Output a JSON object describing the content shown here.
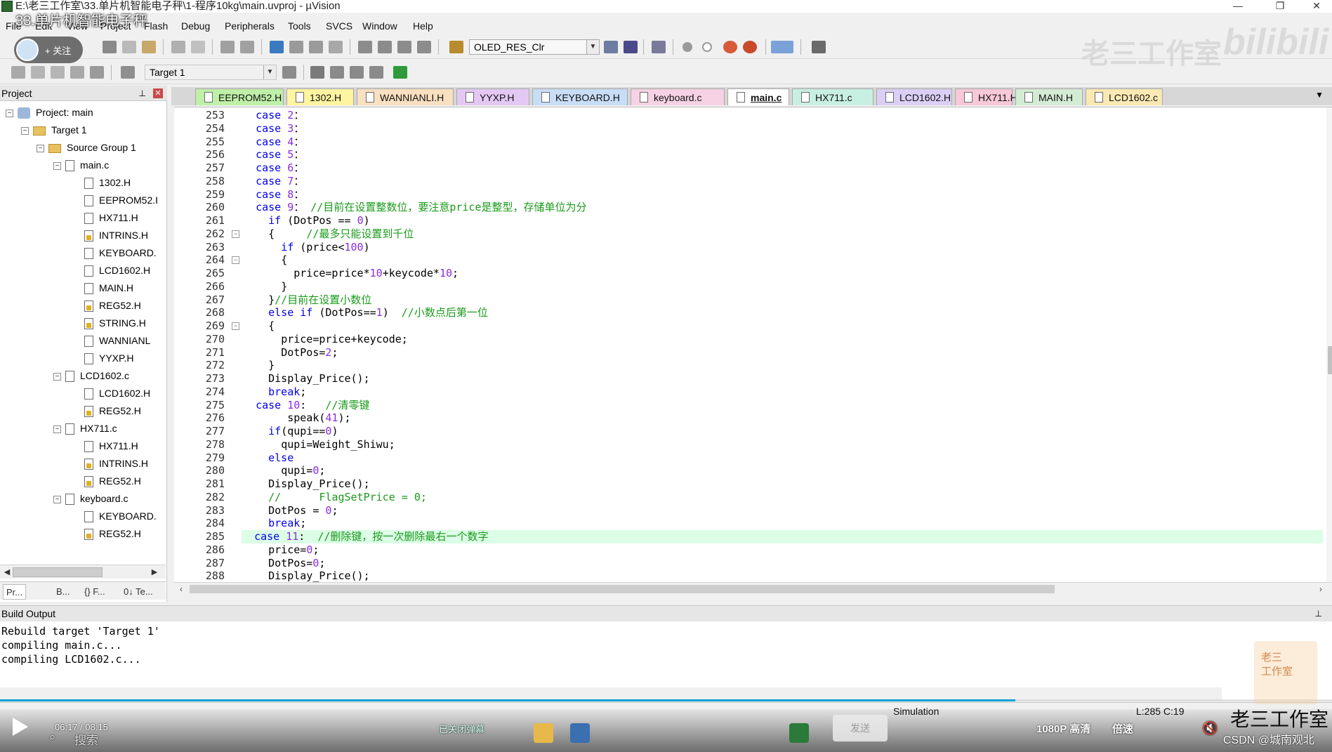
{
  "window": {
    "title": "E:\\老三工作室\\33.单片机智能电子秤\\1-程序10kg\\main.uvproj - µVision",
    "controls": {
      "minimize": "—",
      "maximize": "❐",
      "close": "✕"
    }
  },
  "video_title": "33.单片机智能电子秤",
  "follow": {
    "label": "+ 关注"
  },
  "menu": [
    "File",
    "Edit",
    "View",
    "Project",
    "Flash",
    "Debug",
    "Peripherals",
    "Tools",
    "SVCS",
    "Window",
    "Help"
  ],
  "toolbar": {
    "function_combo": "OLED_RES_Clr",
    "target_combo": "Target 1"
  },
  "project_panel": {
    "title": "Project",
    "tree": [
      {
        "label": "Project: main",
        "level": 0,
        "toggle": "-",
        "icon": "project"
      },
      {
        "label": "Target 1",
        "level": 1,
        "toggle": "-",
        "icon": "folder"
      },
      {
        "label": "Source Group 1",
        "level": 2,
        "toggle": "-",
        "icon": "folder"
      },
      {
        "label": "main.c",
        "level": 3,
        "toggle": "-",
        "icon": "file"
      },
      {
        "label": "1302.H",
        "level": 4,
        "icon": "file"
      },
      {
        "label": "EEPROM52.I",
        "level": 4,
        "icon": "file"
      },
      {
        "label": "HX711.H",
        "level": 4,
        "icon": "file"
      },
      {
        "label": "INTRINS.H",
        "level": 4,
        "icon": "file-lock"
      },
      {
        "label": "KEYBOARD.",
        "level": 4,
        "icon": "file"
      },
      {
        "label": "LCD1602.H",
        "level": 4,
        "icon": "file"
      },
      {
        "label": "MAIN.H",
        "level": 4,
        "icon": "file"
      },
      {
        "label": "REG52.H",
        "level": 4,
        "icon": "file-lock"
      },
      {
        "label": "STRING.H",
        "level": 4,
        "icon": "file-lock"
      },
      {
        "label": "WANNIANL",
        "level": 4,
        "icon": "file"
      },
      {
        "label": "YYXP.H",
        "level": 4,
        "icon": "file"
      },
      {
        "label": "LCD1602.c",
        "level": 3,
        "toggle": "-",
        "icon": "file"
      },
      {
        "label": "LCD1602.H",
        "level": 4,
        "icon": "file"
      },
      {
        "label": "REG52.H",
        "level": 4,
        "icon": "file-lock"
      },
      {
        "label": "HX711.c",
        "level": 3,
        "toggle": "-",
        "icon": "file"
      },
      {
        "label": "HX711.H",
        "level": 4,
        "icon": "file"
      },
      {
        "label": "INTRINS.H",
        "level": 4,
        "icon": "file-lock"
      },
      {
        "label": "REG52.H",
        "level": 4,
        "icon": "file-lock"
      },
      {
        "label": "keyboard.c",
        "level": 3,
        "toggle": "-",
        "icon": "file"
      },
      {
        "label": "KEYBOARD.",
        "level": 4,
        "icon": "file"
      },
      {
        "label": "REG52.H",
        "level": 4,
        "icon": "file-lock"
      }
    ],
    "bottom_tabs": [
      "Pr...",
      "B...",
      "{} F...",
      "0↓ Te..."
    ]
  },
  "editor_tabs": [
    {
      "label": "EEPROM52.H",
      "color": "#bff0a8",
      "active": false
    },
    {
      "label": "1302.H",
      "color": "#fff4a0",
      "active": false
    },
    {
      "label": "WANNIANLI.H",
      "color": "#f8e0c0",
      "active": false
    },
    {
      "label": "YYXP.H",
      "color": "#e4c8f4",
      "active": false
    },
    {
      "label": "KEYBOARD.H",
      "color": "#c8ddf6",
      "active": false
    },
    {
      "label": "keyboard.c",
      "color": "#f6d2e4",
      "active": false
    },
    {
      "label": "main.c",
      "color": "#fff3d6",
      "active": true
    },
    {
      "label": "HX711.c",
      "color": "#c8f0e2",
      "active": false
    },
    {
      "label": "LCD1602.H",
      "color": "#dccff6",
      "active": false
    },
    {
      "label": "HX711.H",
      "color": "#f6c8d8",
      "active": false
    },
    {
      "label": "MAIN.H",
      "color": "#d4ecd4",
      "active": false
    },
    {
      "label": "LCD1602.c",
      "color": "#fbe9b4",
      "active": false
    }
  ],
  "code": {
    "current_line": 285,
    "lines": [
      {
        "n": 253,
        "indent": 2,
        "parts": [
          [
            "kw",
            "case "
          ],
          [
            "num",
            "2"
          ],
          [
            "",
            "："
          ]
        ]
      },
      {
        "n": 254,
        "indent": 2,
        "parts": [
          [
            "kw",
            "case "
          ],
          [
            "num",
            "3"
          ],
          [
            "",
            "："
          ]
        ]
      },
      {
        "n": 255,
        "indent": 2,
        "parts": [
          [
            "kw",
            "case "
          ],
          [
            "num",
            "4"
          ],
          [
            "",
            "："
          ]
        ]
      },
      {
        "n": 256,
        "indent": 2,
        "parts": [
          [
            "kw",
            "case "
          ],
          [
            "num",
            "5"
          ],
          [
            "",
            "："
          ]
        ]
      },
      {
        "n": 257,
        "indent": 2,
        "parts": [
          [
            "kw",
            "case "
          ],
          [
            "num",
            "6"
          ],
          [
            "",
            "："
          ]
        ]
      },
      {
        "n": 258,
        "indent": 2,
        "parts": [
          [
            "kw",
            "case "
          ],
          [
            "num",
            "7"
          ],
          [
            "",
            "："
          ]
        ]
      },
      {
        "n": 259,
        "indent": 2,
        "parts": [
          [
            "kw",
            "case "
          ],
          [
            "num",
            "8"
          ],
          [
            "",
            "："
          ]
        ]
      },
      {
        "n": 260,
        "indent": 2,
        "parts": [
          [
            "kw",
            "case "
          ],
          [
            "num",
            "9"
          ],
          [
            "",
            "： "
          ],
          [
            "cmt",
            "//目前在设置整数位，要注意price是整型，存储单位为分"
          ]
        ]
      },
      {
        "n": 261,
        "indent": 4,
        "parts": [
          [
            "kw",
            "if "
          ],
          [
            "",
            "(DotPos == "
          ],
          [
            "num",
            "0"
          ],
          [
            "",
            ")"
          ]
        ]
      },
      {
        "n": 262,
        "indent": 4,
        "fold": "-",
        "parts": [
          [
            "",
            "{     "
          ],
          [
            "cmt",
            "//最多只能设置到千位"
          ]
        ]
      },
      {
        "n": 263,
        "indent": 6,
        "parts": [
          [
            "kw",
            "if "
          ],
          [
            "",
            "(price<"
          ],
          [
            "num",
            "100"
          ],
          [
            "",
            ")"
          ]
        ]
      },
      {
        "n": 264,
        "indent": 6,
        "fold": "-",
        "parts": [
          [
            "",
            "{"
          ]
        ]
      },
      {
        "n": 265,
        "indent": 8,
        "parts": [
          [
            "",
            "price=price*"
          ],
          [
            "num",
            "10"
          ],
          [
            "",
            "+keycode*"
          ],
          [
            "num",
            "10"
          ],
          [
            "",
            ";"
          ]
        ]
      },
      {
        "n": 266,
        "indent": 6,
        "parts": [
          [
            "",
            "}"
          ]
        ]
      },
      {
        "n": 267,
        "indent": 4,
        "parts": [
          [
            "",
            "}"
          ],
          [
            "cmt",
            "//目前在设置小数位"
          ]
        ]
      },
      {
        "n": 268,
        "indent": 4,
        "parts": [
          [
            "kw",
            "else if "
          ],
          [
            "",
            "(DotPos=="
          ],
          [
            "num",
            "1"
          ],
          [
            "",
            ")  "
          ],
          [
            "cmt",
            "//小数点后第一位"
          ]
        ]
      },
      {
        "n": 269,
        "indent": 4,
        "fold": "-",
        "parts": [
          [
            "",
            "{"
          ]
        ]
      },
      {
        "n": 270,
        "indent": 6,
        "parts": [
          [
            "",
            "price=price+keycode;"
          ]
        ]
      },
      {
        "n": 271,
        "indent": 6,
        "parts": [
          [
            "",
            "DotPos="
          ],
          [
            "num",
            "2"
          ],
          [
            "",
            ";"
          ]
        ]
      },
      {
        "n": 272,
        "indent": 4,
        "parts": [
          [
            "",
            "}"
          ]
        ]
      },
      {
        "n": 273,
        "indent": 4,
        "parts": [
          [
            "",
            "Display_Price();"
          ]
        ]
      },
      {
        "n": 274,
        "indent": 4,
        "parts": [
          [
            "kw",
            "break"
          ],
          [
            "",
            ";"
          ]
        ]
      },
      {
        "n": 275,
        "indent": 2,
        "parts": [
          [
            "kw",
            "case "
          ],
          [
            "num",
            "10"
          ],
          [
            "",
            ":   "
          ],
          [
            "cmt",
            "//清零键"
          ]
        ]
      },
      {
        "n": 276,
        "indent": 7,
        "parts": [
          [
            "",
            "speak("
          ],
          [
            "num",
            "41"
          ],
          [
            "",
            ");"
          ]
        ]
      },
      {
        "n": 277,
        "indent": 4,
        "parts": [
          [
            "kw",
            "if"
          ],
          [
            "",
            "(qupi=="
          ],
          [
            "num",
            "0"
          ],
          [
            "",
            ")"
          ]
        ]
      },
      {
        "n": 278,
        "indent": 6,
        "parts": [
          [
            "",
            "qupi=Weight_Shiwu;"
          ]
        ]
      },
      {
        "n": 279,
        "indent": 4,
        "parts": [
          [
            "kw",
            "else"
          ]
        ]
      },
      {
        "n": 280,
        "indent": 6,
        "parts": [
          [
            "",
            "qupi="
          ],
          [
            "num",
            "0"
          ],
          [
            "",
            ";"
          ]
        ]
      },
      {
        "n": 281,
        "indent": 4,
        "parts": [
          [
            "",
            "Display_Price();"
          ]
        ]
      },
      {
        "n": 282,
        "indent": 4,
        "parts": [
          [
            "cmt",
            "//      FlagSetPrice = 0;"
          ]
        ]
      },
      {
        "n": 283,
        "indent": 4,
        "parts": [
          [
            "",
            "DotPos = "
          ],
          [
            "num",
            "0"
          ],
          [
            "",
            ";"
          ]
        ]
      },
      {
        "n": 284,
        "indent": 4,
        "parts": [
          [
            "kw",
            "break"
          ],
          [
            "",
            ";"
          ]
        ]
      },
      {
        "n": 285,
        "indent": 2,
        "parts": [
          [
            "kw",
            "case "
          ],
          [
            "num",
            "11"
          ],
          [
            "",
            ":  "
          ],
          [
            "cmt",
            "//删除键，按一次删除最右一个数字"
          ]
        ]
      },
      {
        "n": 286,
        "indent": 4,
        "parts": [
          [
            "",
            "price="
          ],
          [
            "num",
            "0"
          ],
          [
            "",
            ";"
          ]
        ]
      },
      {
        "n": 287,
        "indent": 4,
        "parts": [
          [
            "",
            "DotPos="
          ],
          [
            "num",
            "0"
          ],
          [
            "",
            ";"
          ]
        ]
      },
      {
        "n": 288,
        "indent": 4,
        "parts": [
          [
            "",
            "Display_Price();"
          ]
        ]
      }
    ]
  },
  "build_output": {
    "title": "Build Output",
    "lines": [
      "Rebuild target 'Target 1'",
      "compiling main.c...",
      "compiling LCD1602.c..."
    ]
  },
  "status": {
    "mode": "Simulation",
    "position": "L:285 C:19"
  },
  "video": {
    "time": "06:17 / 08:15",
    "progress": 0.762,
    "search_placeholder": "搜索",
    "danmaku_off": "已关闭弹幕",
    "send": "发送",
    "quality": "1080P 高清",
    "speed": "倍速"
  },
  "watermark": {
    "channel": "老三工作室",
    "site": "bilibili",
    "csdn": "CSDN @城南观北",
    "side_logo": "老三\n工作室"
  }
}
